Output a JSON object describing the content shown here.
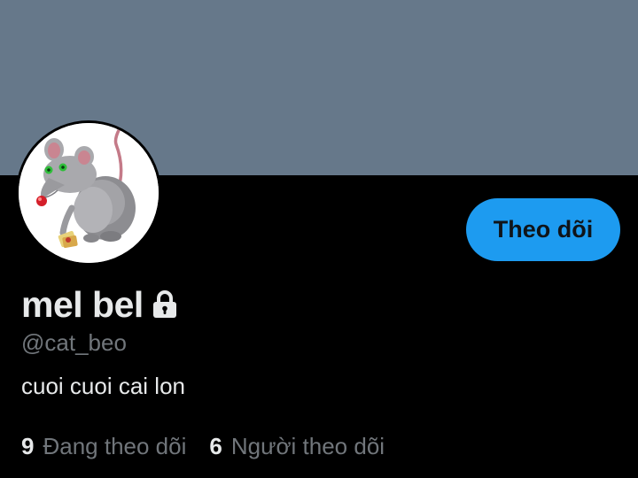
{
  "colors": {
    "banner": "#66788a",
    "background": "#000000",
    "accent": "#1d9bf0",
    "text_primary": "#e7e9ea",
    "text_secondary": "#71767b"
  },
  "profile": {
    "display_name": "mel bel",
    "protected_icon": "lock-icon",
    "handle": "@cat_beo",
    "bio": "cuoi cuoi cai lon",
    "avatar_description": "grey cartoon rat"
  },
  "actions": {
    "follow_label": "Theo dõi"
  },
  "stats": {
    "following_count": "9",
    "following_label": "Đang theo dõi",
    "followers_count": "6",
    "followers_label": "Người theo dõi"
  }
}
